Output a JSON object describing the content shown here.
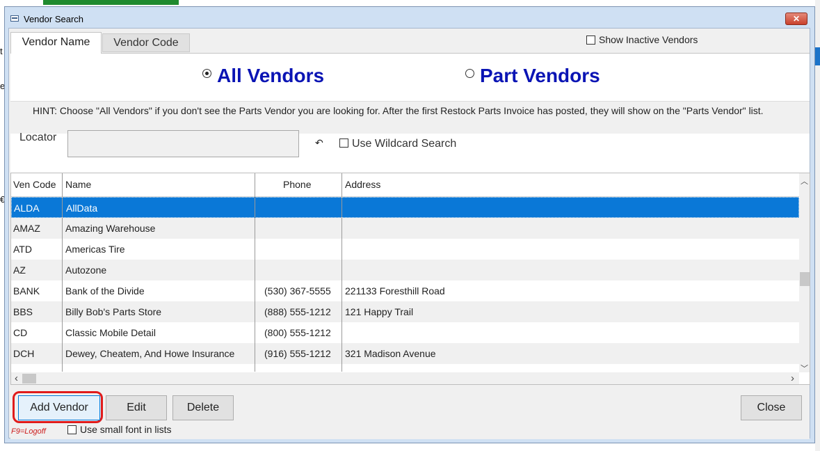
{
  "window": {
    "title": "Vendor Search",
    "close_glyph": "✕"
  },
  "background": {
    "left_fragments": [
      "t",
      "e",
      "€"
    ]
  },
  "tabs": [
    {
      "label": "Vendor Name",
      "active": true
    },
    {
      "label": "Vendor Code",
      "active": false
    }
  ],
  "show_inactive": {
    "label": "Show Inactive Vendors",
    "checked": false
  },
  "radio": {
    "all": {
      "label": "All Vendors",
      "selected": true
    },
    "parts": {
      "label": "Part Vendors",
      "selected": false
    }
  },
  "hint": "HINT: Choose \"All Vendors\" if you don't see the Parts Vendor you are looking for.  After the first Restock Parts Invoice has posted, they will show on the \"Parts Vendor\" list.",
  "locator": {
    "label": "Locator",
    "value": "",
    "placeholder": ""
  },
  "undo_glyph": "↶",
  "wildcard": {
    "label": "Use Wildcard Search",
    "checked": false
  },
  "grid": {
    "headers": [
      "Ven Code",
      "Name",
      "Phone",
      "Address"
    ],
    "rows": [
      {
        "code": "ALDA",
        "name": "AllData",
        "phone": "",
        "address": "",
        "selected": true
      },
      {
        "code": "AMAZ",
        "name": "Amazing Warehouse",
        "phone": "",
        "address": ""
      },
      {
        "code": "ATD",
        "name": "Americas Tire",
        "phone": "",
        "address": ""
      },
      {
        "code": "AZ",
        "name": "Autozone",
        "phone": "",
        "address": ""
      },
      {
        "code": "BANK",
        "name": "Bank of the Divide",
        "phone": "(530) 367-5555",
        "address": "221133 Foresthill Road"
      },
      {
        "code": "BBS",
        "name": "Billy Bob's Parts Store",
        "phone": "(888) 555-1212",
        "address": "121 Happy Trail"
      },
      {
        "code": "CD",
        "name": "Classic Mobile Detail",
        "phone": "(800) 555-1212",
        "address": ""
      },
      {
        "code": "DCH",
        "name": "Dewey, Cheatem, And Howe Insurance",
        "phone": "(916) 555-1212",
        "address": "321 Madison Avenue"
      }
    ],
    "scroll_up": "︿",
    "scroll_down": "﹀",
    "scroll_left": "‹",
    "scroll_right": "›"
  },
  "buttons": {
    "add": "Add Vendor",
    "edit": "Edit",
    "delete": "Delete",
    "close": "Close"
  },
  "shortcut_hint": "F9=Logoff",
  "small_font": {
    "label": "Use small font in lists",
    "checked": false
  },
  "colors": {
    "selection": "#0a78d7",
    "radio_text": "#0a14b4",
    "highlight": "#e01b1b"
  }
}
